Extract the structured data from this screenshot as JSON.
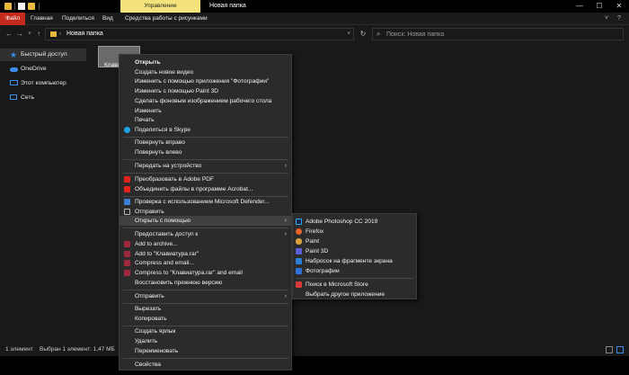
{
  "window": {
    "manage_tab": "Управление",
    "title": "Новая папка",
    "minimize": "—",
    "maximize": "☐",
    "close": "✕"
  },
  "ribbon": {
    "tabs": [
      "Файл",
      "Главная",
      "Поделиться",
      "Вид",
      "Средства работы с рисунками"
    ],
    "collapse": "˅",
    "help": "?"
  },
  "nav": {
    "back": "←",
    "forward": "→",
    "recent": "˅",
    "up": "↑",
    "chevron": "›",
    "address": "Новая папка",
    "address_dropdown": "˅",
    "refresh": "↻"
  },
  "search": {
    "icon": "⌕",
    "placeholder": "Поиск: Новая папка"
  },
  "sidebar": {
    "items": [
      {
        "label": "Быстрый доступ",
        "icon": "star-icon",
        "color": "#3c8de8"
      },
      {
        "label": "OneDrive",
        "icon": "cloud-icon",
        "color": "#3c8de8"
      },
      {
        "label": "Этот компьютер",
        "icon": "computer-icon",
        "color": "#3c8de8"
      },
      {
        "label": "Сеть",
        "icon": "network-icon",
        "color": "#3c8de8"
      }
    ]
  },
  "content": {
    "file_label": "Клави"
  },
  "status": {
    "count": "1 элемент",
    "selection": "Выбран 1 элемент: 1,47 МБ"
  },
  "context_menu": {
    "arrow": "›",
    "items": [
      {
        "label": "Открыть",
        "bold": true
      },
      {
        "label": "Создать новое видео"
      },
      {
        "label": "Изменить с помощью приложения \"Фотографии\""
      },
      {
        "label": "Изменить с помощью Paint 3D"
      },
      {
        "label": "Сделать фоновым изображением рабочего стола"
      },
      {
        "label": "Изменить"
      },
      {
        "label": "Печать"
      },
      {
        "label": "Поделиться в Skype",
        "icon": "skype-icon",
        "color": "#1ea5e8"
      },
      {
        "label": "Повернуть вправо"
      },
      {
        "label": "Повернуть влево"
      },
      {
        "label": "Передать на устройство"
      },
      {
        "label": "Преобразовать в Adobe PDF",
        "icon": "acrobat-icon",
        "color": "#e0231c"
      },
      {
        "label": "Объединить файлы в программе Acrobat...",
        "icon": "acrobat-combine-icon",
        "color": "#e0231c"
      },
      {
        "label": "Проверка с использованием Microsoft Defender...",
        "icon": "defender-icon",
        "color": "#3a7fd5"
      },
      {
        "label": "Отправить",
        "icon": "share-icon",
        "color": "#b8b8b8"
      },
      {
        "label": "Открыть с помощью"
      },
      {
        "label": "Предоставить доступ к"
      },
      {
        "label": "Add to archive...",
        "icon": "winrar-icon",
        "color": "#a0283c"
      },
      {
        "label": "Add to \"Клавиатура.rar\"",
        "icon": "winrar-icon",
        "color": "#a0283c"
      },
      {
        "label": "Compress and email...",
        "icon": "winrar-icon",
        "color": "#a0283c"
      },
      {
        "label": "Compress to \"Клавиатура.rar\" and email",
        "icon": "winrar-icon",
        "color": "#a0283c"
      },
      {
        "label": "Восстановить прежнюю версию"
      },
      {
        "label": "Отправить"
      },
      {
        "label": "Вырезать"
      },
      {
        "label": "Копировать"
      },
      {
        "label": "Создать ярлык"
      },
      {
        "label": "Удалить"
      },
      {
        "label": "Переименовать"
      },
      {
        "label": "Свойства"
      }
    ]
  },
  "open_with_submenu": {
    "items": [
      {
        "label": "Adobe Photoshop CC 2019",
        "icon": "photoshop-icon",
        "color": "#0e2a47"
      },
      {
        "label": "Firefox",
        "icon": "firefox-icon",
        "color": "#e8622a"
      },
      {
        "label": "Paint",
        "icon": "paint-icon",
        "color": "#d9a23a"
      },
      {
        "label": "Paint 3D",
        "icon": "paint3d-icon",
        "color": "#5a5fd8"
      },
      {
        "label": "Набросок на фрагменте экрана",
        "icon": "snip-sketch-icon",
        "color": "#2f7fd8"
      },
      {
        "label": "Фотографии",
        "icon": "photos-icon",
        "color": "#2f6fd8"
      },
      {
        "label": "Поиск в Microsoft Store",
        "icon": "store-icon",
        "color": "#d83a3a"
      },
      {
        "label": "Выбрать другое приложение"
      }
    ]
  }
}
